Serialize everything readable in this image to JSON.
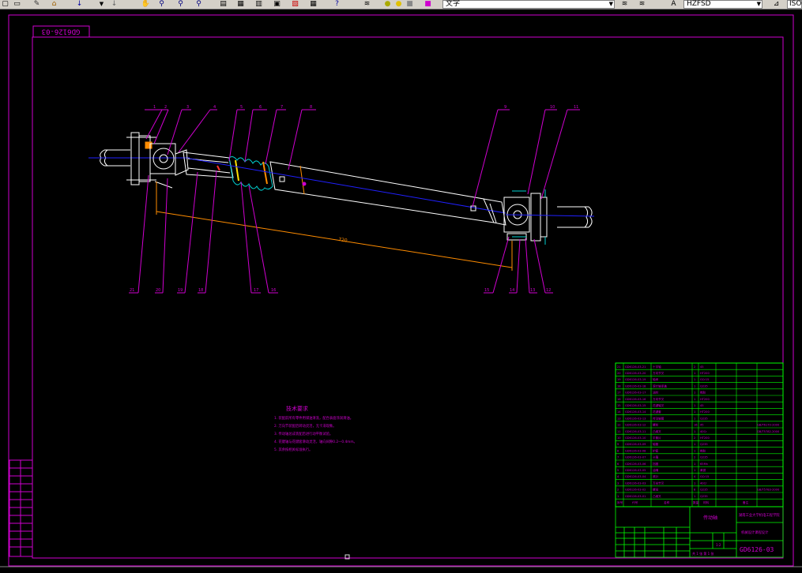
{
  "toolbar": {
    "icons": [
      "new-icon",
      "open-icon",
      "pencil-icon",
      "paintbrush-icon",
      "undo-icon",
      "redo-icon",
      "pan-icon",
      "zoom-realtime-icon",
      "zoom-window-icon",
      "zoom-previous-icon",
      "properties-icon",
      "design-center-icon",
      "tool-palettes-icon",
      "sheet-set-icon",
      "markup-icon",
      "calculator-icon",
      "help-icon",
      "layer-manager-icon",
      "layer-state-icon"
    ],
    "layer_combo": "文字",
    "style_combo": "HZFSD",
    "right_clip": "ISO"
  },
  "drawing": {
    "frame_code": "GD6126-03",
    "balloon_top": [
      "1",
      "2",
      "3",
      "4",
      "5",
      "6",
      "7",
      "8",
      "9",
      "10",
      "11"
    ],
    "balloon_bottom": [
      "21",
      "20",
      "19",
      "18",
      "17",
      "16",
      "15",
      "14",
      "13",
      "12"
    ],
    "dimension": "720",
    "tech_requirements": {
      "title": "技术要求",
      "items": [
        "1. 装配前所有零件用煤油清洗，配合表面涂润滑油。",
        "2. 万向节装配后转动灵活，无卡滞现象。",
        "3. 传动轴总成装配后进行动平衡试验。",
        "4. 花键轴与花键套滑动灵活，轴向间隙0.2—0.4mm。",
        "5. 其余按相关标准执行。"
      ]
    },
    "bom_rows": [
      [
        "21",
        "GD6126-03-21",
        "十字轴",
        "2",
        "45"
      ],
      [
        "20",
        "GD6126-03-20",
        "万向节叉",
        "1",
        "HT200"
      ],
      [
        "19",
        "GD6126-03-19",
        "轴承",
        "1",
        "GCr15"
      ],
      [
        "18",
        "GD6126-03-18",
        "滚针轴承盖",
        "1",
        "Q235"
      ],
      [
        "17",
        "GD6126-03-17",
        "油封",
        "1",
        "橡胶"
      ],
      [
        "16",
        "GD6126-03-16",
        "万向节叉",
        "1",
        "HT200"
      ],
      [
        "15",
        "GD6126-03-15",
        "花键轴叉",
        "1",
        "45"
      ],
      [
        "14",
        "GD6126-03-14",
        "花键套",
        "1",
        "HT200"
      ],
      [
        "13",
        "GD6126-03-13",
        "传动轴管",
        "1",
        "Q235"
      ],
      [
        "12",
        "GD6126-03-12",
        "螺栓",
        "16",
        "45"
      ],
      [
        "11",
        "GD6126-03-11",
        "凸缘叉",
        "1",
        "40Cr"
      ],
      [
        "10",
        "GD6126-03-10",
        "平衡片",
        "2",
        "HT200"
      ],
      [
        "9",
        "GD6126-03-09",
        "轴管",
        "1",
        "Q235"
      ],
      [
        "8",
        "GD6126-03-08",
        "护套",
        "1",
        "橡胶"
      ],
      [
        "7",
        "GD6126-03-07",
        "卡箍",
        "2",
        "Q235"
      ],
      [
        "6",
        "GD6126-03-06",
        "挡圈",
        "1",
        "65Mn"
      ],
      [
        "5",
        "GD6126-03-05",
        "油嘴",
        "1",
        "黄铜"
      ],
      [
        "4",
        "GD6126-03-04",
        "滚针",
        "4",
        "GCr15"
      ],
      [
        "3",
        "GD6126-03-03",
        "万向节叉",
        "1",
        "40Cr"
      ],
      [
        "2",
        "GD6126-03-02",
        "螺母",
        "8",
        "Q235"
      ],
      [
        "1",
        "GD6126-03-01",
        "凸缘叉",
        "1",
        "Q235"
      ]
    ],
    "bom_notes": {
      "r10": "GB/T5782-2000",
      "r11": "GB/T6170-2000",
      "r20": "GB/T5783-2000"
    },
    "bom_header": [
      "序号",
      "代号",
      "名称",
      "数量",
      "材料",
      "备注"
    ],
    "title_block": {
      "drawing_name": "传动轴",
      "school": "湖南工业大学机电工程学院",
      "course": "机械设计课程设计",
      "drawing_number": "GD6126-03",
      "scale": "1:2",
      "sheet": "共 1 张 第 1 张"
    }
  }
}
